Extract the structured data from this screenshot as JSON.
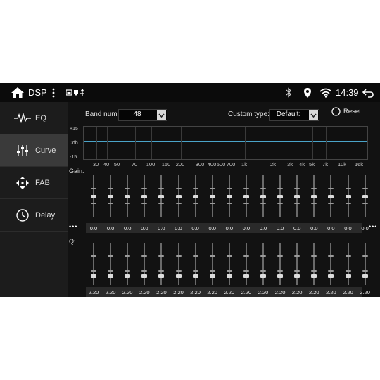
{
  "status": {
    "title": "DSP",
    "time": "14:39"
  },
  "sidebar": {
    "items": [
      {
        "label": "EQ",
        "icon": "waveform-icon"
      },
      {
        "label": "Curve",
        "icon": "sliders-icon"
      },
      {
        "label": "FAB",
        "icon": "arrows-icon"
      },
      {
        "label": "Delay",
        "icon": "clock-icon"
      }
    ],
    "active": 1
  },
  "toolbar": {
    "band_num_label": "Band num:",
    "band_num_value": "48",
    "custom_type_label": "Custom type:",
    "custom_type_value": "Default:",
    "reset_label": "Reset"
  },
  "curve": {
    "y_labels": [
      "+15",
      "0db",
      "-15"
    ],
    "x_labels": [
      "30",
      "40",
      "50",
      "70",
      "100",
      "150",
      "200",
      "300",
      "400",
      "500",
      "700",
      "1k",
      "2k",
      "3k",
      "4k",
      "5k",
      "7k",
      "10k",
      "16k"
    ]
  },
  "gain": {
    "label": "Gain:",
    "values": [
      "0.0",
      "0.0",
      "0.0",
      "0.0",
      "0.0",
      "0.0",
      "0.0",
      "0.0",
      "0.0",
      "0.0",
      "0.0",
      "0.0",
      "0.0",
      "0.0",
      "0.0",
      "0.0",
      "0.0"
    ],
    "level": 0.5
  },
  "q": {
    "label": "Q:",
    "values": [
      "2.20",
      "2.20",
      "2.20",
      "2.20",
      "2.20",
      "2.20",
      "2.20",
      "2.20",
      "2.20",
      "2.20",
      "2.20",
      "2.20",
      "2.20",
      "2.20",
      "2.20",
      "2.20",
      "2.20"
    ],
    "level": 0.5
  },
  "more_dots": "•••",
  "colors": {
    "accent": "#4aa3c8",
    "active_nav": "#3a3a3a"
  }
}
